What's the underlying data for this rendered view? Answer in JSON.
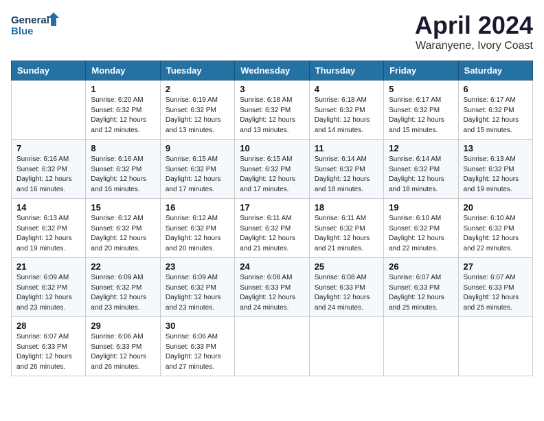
{
  "logo": {
    "line1": "General",
    "line2": "Blue"
  },
  "title": "April 2024",
  "location": "Waranyene, Ivory Coast",
  "days_of_week": [
    "Sunday",
    "Monday",
    "Tuesday",
    "Wednesday",
    "Thursday",
    "Friday",
    "Saturday"
  ],
  "weeks": [
    [
      {
        "day": "",
        "sunrise": "",
        "sunset": "",
        "daylight": ""
      },
      {
        "day": "1",
        "sunrise": "6:20 AM",
        "sunset": "6:32 PM",
        "daylight": "12 hours and 12 minutes."
      },
      {
        "day": "2",
        "sunrise": "6:19 AM",
        "sunset": "6:32 PM",
        "daylight": "12 hours and 13 minutes."
      },
      {
        "day": "3",
        "sunrise": "6:18 AM",
        "sunset": "6:32 PM",
        "daylight": "12 hours and 13 minutes."
      },
      {
        "day": "4",
        "sunrise": "6:18 AM",
        "sunset": "6:32 PM",
        "daylight": "12 hours and 14 minutes."
      },
      {
        "day": "5",
        "sunrise": "6:17 AM",
        "sunset": "6:32 PM",
        "daylight": "12 hours and 15 minutes."
      },
      {
        "day": "6",
        "sunrise": "6:17 AM",
        "sunset": "6:32 PM",
        "daylight": "12 hours and 15 minutes."
      }
    ],
    [
      {
        "day": "7",
        "sunrise": "6:16 AM",
        "sunset": "6:32 PM",
        "daylight": "12 hours and 16 minutes."
      },
      {
        "day": "8",
        "sunrise": "6:16 AM",
        "sunset": "6:32 PM",
        "daylight": "12 hours and 16 minutes."
      },
      {
        "day": "9",
        "sunrise": "6:15 AM",
        "sunset": "6:32 PM",
        "daylight": "12 hours and 17 minutes."
      },
      {
        "day": "10",
        "sunrise": "6:15 AM",
        "sunset": "6:32 PM",
        "daylight": "12 hours and 17 minutes."
      },
      {
        "day": "11",
        "sunrise": "6:14 AM",
        "sunset": "6:32 PM",
        "daylight": "12 hours and 18 minutes."
      },
      {
        "day": "12",
        "sunrise": "6:14 AM",
        "sunset": "6:32 PM",
        "daylight": "12 hours and 18 minutes."
      },
      {
        "day": "13",
        "sunrise": "6:13 AM",
        "sunset": "6:32 PM",
        "daylight": "12 hours and 19 minutes."
      }
    ],
    [
      {
        "day": "14",
        "sunrise": "6:13 AM",
        "sunset": "6:32 PM",
        "daylight": "12 hours and 19 minutes."
      },
      {
        "day": "15",
        "sunrise": "6:12 AM",
        "sunset": "6:32 PM",
        "daylight": "12 hours and 20 minutes."
      },
      {
        "day": "16",
        "sunrise": "6:12 AM",
        "sunset": "6:32 PM",
        "daylight": "12 hours and 20 minutes."
      },
      {
        "day": "17",
        "sunrise": "6:11 AM",
        "sunset": "6:32 PM",
        "daylight": "12 hours and 21 minutes."
      },
      {
        "day": "18",
        "sunrise": "6:11 AM",
        "sunset": "6:32 PM",
        "daylight": "12 hours and 21 minutes."
      },
      {
        "day": "19",
        "sunrise": "6:10 AM",
        "sunset": "6:32 PM",
        "daylight": "12 hours and 22 minutes."
      },
      {
        "day": "20",
        "sunrise": "6:10 AM",
        "sunset": "6:32 PM",
        "daylight": "12 hours and 22 minutes."
      }
    ],
    [
      {
        "day": "21",
        "sunrise": "6:09 AM",
        "sunset": "6:32 PM",
        "daylight": "12 hours and 23 minutes."
      },
      {
        "day": "22",
        "sunrise": "6:09 AM",
        "sunset": "6:32 PM",
        "daylight": "12 hours and 23 minutes."
      },
      {
        "day": "23",
        "sunrise": "6:09 AM",
        "sunset": "6:32 PM",
        "daylight": "12 hours and 23 minutes."
      },
      {
        "day": "24",
        "sunrise": "6:08 AM",
        "sunset": "6:33 PM",
        "daylight": "12 hours and 24 minutes."
      },
      {
        "day": "25",
        "sunrise": "6:08 AM",
        "sunset": "6:33 PM",
        "daylight": "12 hours and 24 minutes."
      },
      {
        "day": "26",
        "sunrise": "6:07 AM",
        "sunset": "6:33 PM",
        "daylight": "12 hours and 25 minutes."
      },
      {
        "day": "27",
        "sunrise": "6:07 AM",
        "sunset": "6:33 PM",
        "daylight": "12 hours and 25 minutes."
      }
    ],
    [
      {
        "day": "28",
        "sunrise": "6:07 AM",
        "sunset": "6:33 PM",
        "daylight": "12 hours and 26 minutes."
      },
      {
        "day": "29",
        "sunrise": "6:06 AM",
        "sunset": "6:33 PM",
        "daylight": "12 hours and 26 minutes."
      },
      {
        "day": "30",
        "sunrise": "6:06 AM",
        "sunset": "6:33 PM",
        "daylight": "12 hours and 27 minutes."
      },
      {
        "day": "",
        "sunrise": "",
        "sunset": "",
        "daylight": ""
      },
      {
        "day": "",
        "sunrise": "",
        "sunset": "",
        "daylight": ""
      },
      {
        "day": "",
        "sunrise": "",
        "sunset": "",
        "daylight": ""
      },
      {
        "day": "",
        "sunrise": "",
        "sunset": "",
        "daylight": ""
      }
    ]
  ],
  "labels": {
    "sunrise_prefix": "Sunrise: ",
    "sunset_prefix": "Sunset: ",
    "daylight_prefix": "Daylight: "
  }
}
